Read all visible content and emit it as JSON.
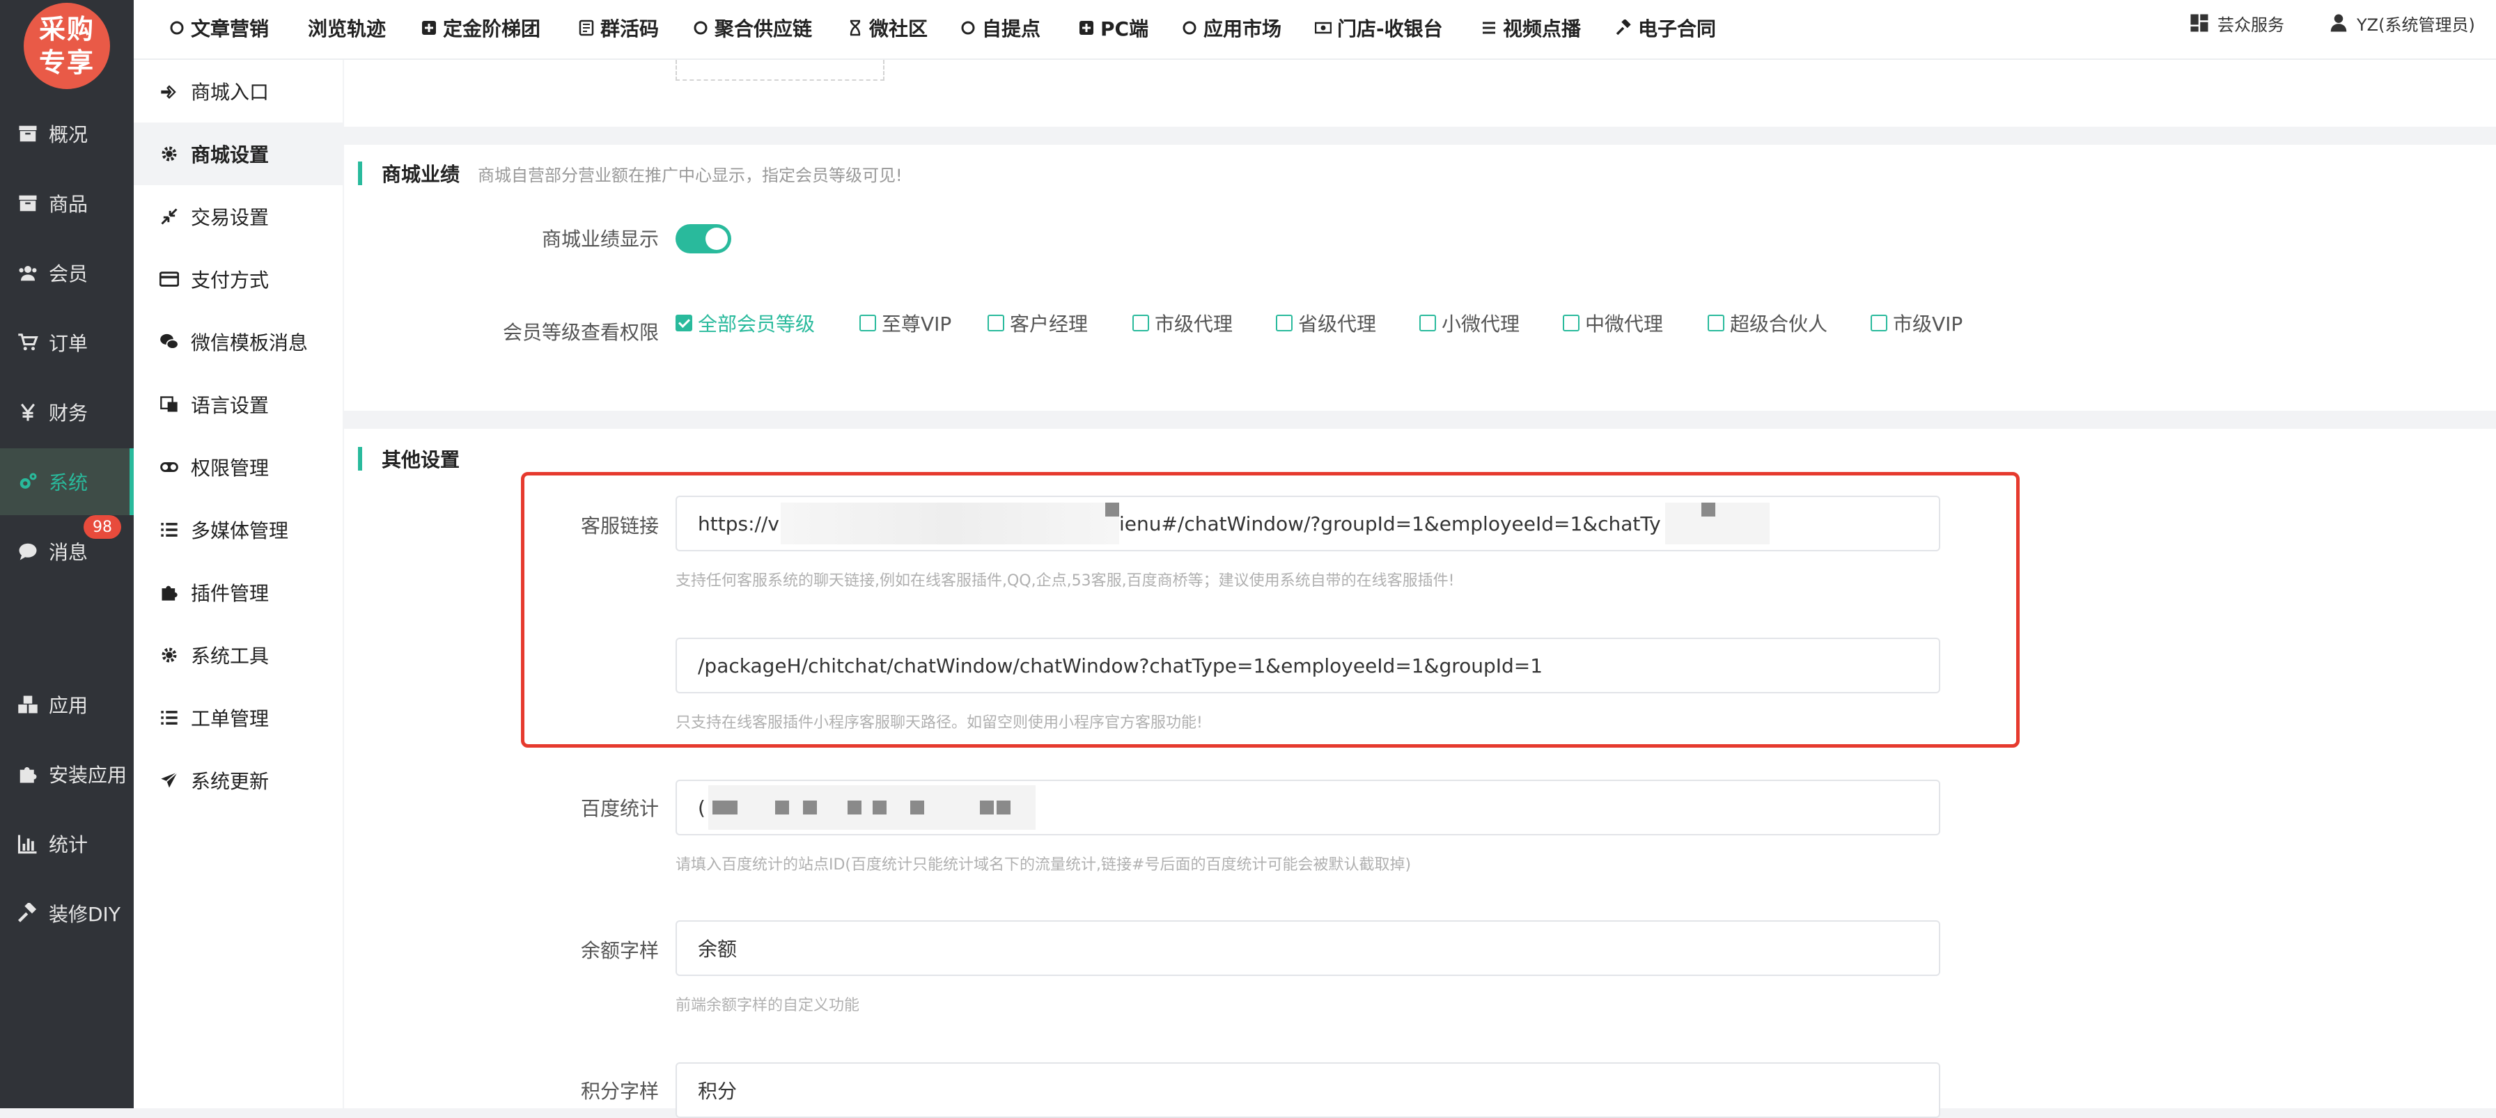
{
  "logo": {
    "text": "采购专享",
    "bg_color": "#e95a47"
  },
  "sidebar": {
    "items": [
      {
        "label": "概况",
        "icon": "archive-icon"
      },
      {
        "label": "商品",
        "icon": "box-icon"
      },
      {
        "label": "会员",
        "icon": "users-icon"
      },
      {
        "label": "订单",
        "icon": "cart-icon"
      },
      {
        "label": "财务",
        "icon": "yen-icon"
      },
      {
        "label": "系统",
        "icon": "cogs-icon",
        "active": true
      },
      {
        "label": "消息",
        "icon": "chat-icon",
        "badge": "98"
      },
      {
        "label": "应用",
        "icon": "cubes-icon"
      },
      {
        "label": "安装应用",
        "icon": "puzzle-icon"
      },
      {
        "label": "统计",
        "icon": "bar-chart-icon"
      },
      {
        "label": "装修DIY",
        "icon": "gavel-icon"
      }
    ],
    "bg_color": "#303338",
    "accent_color": "#29ba9c"
  },
  "submenu": {
    "items": [
      {
        "label": "商城入口",
        "icon": "hand-pointer-icon"
      },
      {
        "label": "商城设置",
        "icon": "gear-icon",
        "active": true
      },
      {
        "label": "交易设置",
        "icon": "compress-icon"
      },
      {
        "label": "支付方式",
        "icon": "credit-card-icon"
      },
      {
        "label": "微信模板消息",
        "icon": "wechat-icon"
      },
      {
        "label": "语言设置",
        "icon": "language-icon"
      },
      {
        "label": "权限管理",
        "icon": "toggle-icon"
      },
      {
        "label": "多媒体管理",
        "icon": "list-icon"
      },
      {
        "label": "插件管理",
        "icon": "puzzle-icon"
      },
      {
        "label": "系统工具",
        "icon": "gear-icon"
      },
      {
        "label": "工单管理",
        "icon": "list-icon"
      },
      {
        "label": "系统更新",
        "icon": "paper-plane-icon"
      }
    ]
  },
  "topnav": {
    "items": [
      {
        "label": "文章营销",
        "icon": "circle-icon"
      },
      {
        "label": "浏览轨迹",
        "icon": ""
      },
      {
        "label": "定金阶梯团",
        "icon": "plus-square-icon"
      },
      {
        "label": "群活码",
        "icon": "qrcode-icon"
      },
      {
        "label": "聚合供应链",
        "icon": "circle-icon"
      },
      {
        "label": "微社区",
        "icon": "hourglass-icon"
      },
      {
        "label": "自提点",
        "icon": "circle-icon"
      },
      {
        "label": "PC端",
        "icon": "plus-square-icon"
      },
      {
        "label": "应用市场",
        "icon": "circle-icon"
      },
      {
        "label": "门店-收银台",
        "icon": "money-icon"
      },
      {
        "label": "视频点播",
        "icon": "bars-icon"
      },
      {
        "label": "电子合同",
        "icon": "gavel-icon"
      }
    ],
    "service": {
      "label": "芸众服务",
      "icon": "dashboard-icon"
    },
    "user": {
      "label": "YZ(系统管理员)",
      "icon": "user-icon"
    }
  },
  "perf_section": {
    "title": "商城业绩",
    "desc": "商城自营部分营业额在推广中心显示，指定会员等级可见!",
    "toggle_label": "商城业绩显示",
    "toggle_on": true,
    "levels_label": "会员等级查看权限",
    "levels": [
      {
        "label": "全部会员等级",
        "checked": true
      },
      {
        "label": "至尊VIP",
        "checked": false
      },
      {
        "label": "客户经理",
        "checked": false
      },
      {
        "label": "市级代理",
        "checked": false
      },
      {
        "label": "省级代理",
        "checked": false
      },
      {
        "label": "小微代理",
        "checked": false
      },
      {
        "label": "中微代理",
        "checked": false
      },
      {
        "label": "超级合伙人",
        "checked": false
      },
      {
        "label": "市级VIP",
        "checked": false
      }
    ]
  },
  "other_section": {
    "title": "其他设置",
    "service_link": {
      "label": "客服链接",
      "value_prefix": "https://v",
      "value_suffix": "ienu#/chatWindow/?groupId=1&employeeId=1&chatTy",
      "help": "支持任何客服系统的聊天链接,例如在线客服插件,QQ,企点,53客服,百度商桥等；建议使用系统自带的在线客服插件!"
    },
    "mini_link": {
      "value": "/packageH/chitchat/chatWindow/chatWindow?chatType=1&employeeId=1&groupId=1",
      "help": "只支持在线客服插件小程序客服聊天路径。如留空则使用小程序官方客服功能!"
    },
    "baidu": {
      "label": "百度统计",
      "value_prefix": "(",
      "help": "请填入百度统计的站点ID(百度统计只能统计域名下的流量统计,链接#号后面的百度统计可能会被默认截取掉)"
    },
    "balance": {
      "label": "余额字样",
      "value": "余额",
      "help": "前端余额字样的自定义功能"
    },
    "points": {
      "label": "积分字样",
      "value": "积分"
    },
    "highlight_color": "#e63a2e"
  }
}
